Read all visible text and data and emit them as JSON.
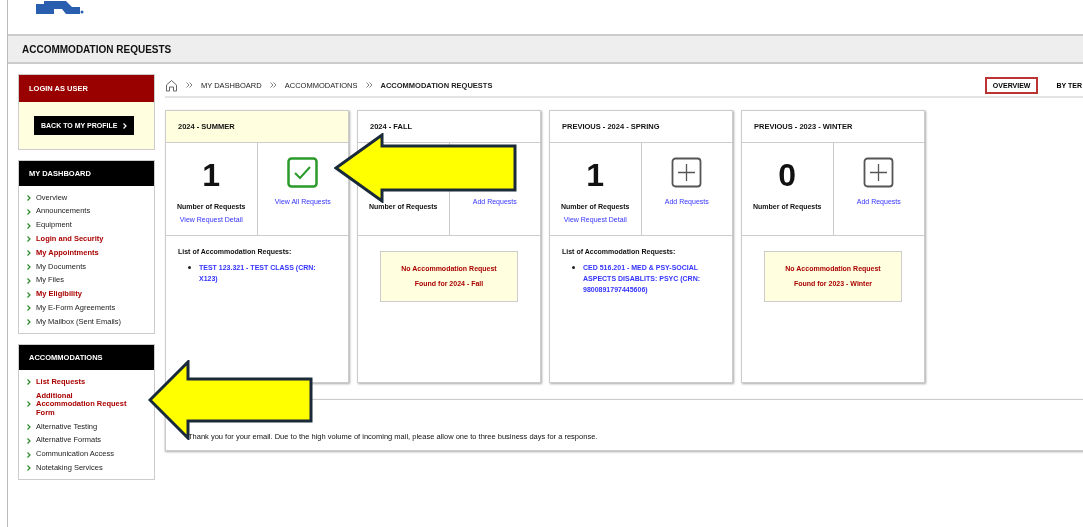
{
  "header": {
    "title": "ACCOMMODATION REQUESTS"
  },
  "sidebar": {
    "login_title": "LOGIN AS USER",
    "back_button": "BACK TO MY PROFILE",
    "sections": [
      {
        "title": "MY DASHBOARD",
        "items": [
          {
            "label": "Overview",
            "highlighted": false
          },
          {
            "label": "Announcements",
            "highlighted": false
          },
          {
            "label": "Equipment",
            "highlighted": false
          },
          {
            "label": "Login and Security",
            "highlighted": true
          },
          {
            "label": "My Appointments",
            "highlighted": true
          },
          {
            "label": "My Documents",
            "highlighted": false
          },
          {
            "label": "My Files",
            "highlighted": false
          },
          {
            "label": "My Eligibility",
            "highlighted": true
          },
          {
            "label": "My E-Form Agreements",
            "highlighted": false
          },
          {
            "label": "My Mailbox (Sent Emails)",
            "highlighted": false
          }
        ]
      },
      {
        "title": "ACCOMMODATIONS",
        "items": [
          {
            "label": "List Requests",
            "highlighted": true
          },
          {
            "label": "Additional Accommodation Request Form",
            "highlighted": true
          },
          {
            "label": "Alternative Testing",
            "highlighted": false
          },
          {
            "label": "Alternative Formats",
            "highlighted": false
          },
          {
            "label": "Communication Access",
            "highlighted": false
          },
          {
            "label": "Notetaking Services",
            "highlighted": false
          }
        ]
      }
    ]
  },
  "breadcrumb": [
    "MY DASHBOARD",
    "ACCOMMODATIONS",
    "ACCOMMODATION REQUESTS"
  ],
  "view_tabs": [
    {
      "label": "OVERVIEW",
      "selected": true
    },
    {
      "label": "BY TER",
      "selected": false
    }
  ],
  "terms": [
    {
      "title": "2024 - SUMMER",
      "current": true,
      "count": "1",
      "count_label": "Number of Requests",
      "detail_link": "View Request Detail",
      "action": {
        "kind": "check",
        "label": "View All Requests"
      },
      "list_title": "List of Accommodation Requests:",
      "requests": [
        "TEST 123.321 - TEST CLASS (CRN: X123)"
      ]
    },
    {
      "title": "2024 - FALL",
      "current": false,
      "count_label": "Number of Requests",
      "action": {
        "label": "Add Requests"
      },
      "empty_message": "No Accommodation Request Found for 2024 - Fall"
    },
    {
      "title": "PREVIOUS - 2024 - SPRING",
      "current": false,
      "count": "1",
      "count_label": "Number of Requests",
      "detail_link": "View Request Detail",
      "action": {
        "kind": "add",
        "label": "Add Requests"
      },
      "list_title": "List of Accommodation Requests:",
      "requests": [
        "CED 516.201 - MED & PSY-SOCIAL ASPECTS DISABLITS: PSYC (CRN: 9800891797445606)"
      ]
    },
    {
      "title": "PREVIOUS - 2023 - WINTER",
      "current": false,
      "count": "0",
      "count_label": "Number of Requests",
      "action": {
        "kind": "add",
        "label": "Add Requests"
      },
      "empty_message": "No Accommodation Request Found for 2023 - Winter"
    }
  ],
  "message": "Thank you for your email. Due to the high volume of incoming mail, please allow one to three business days for a response."
}
